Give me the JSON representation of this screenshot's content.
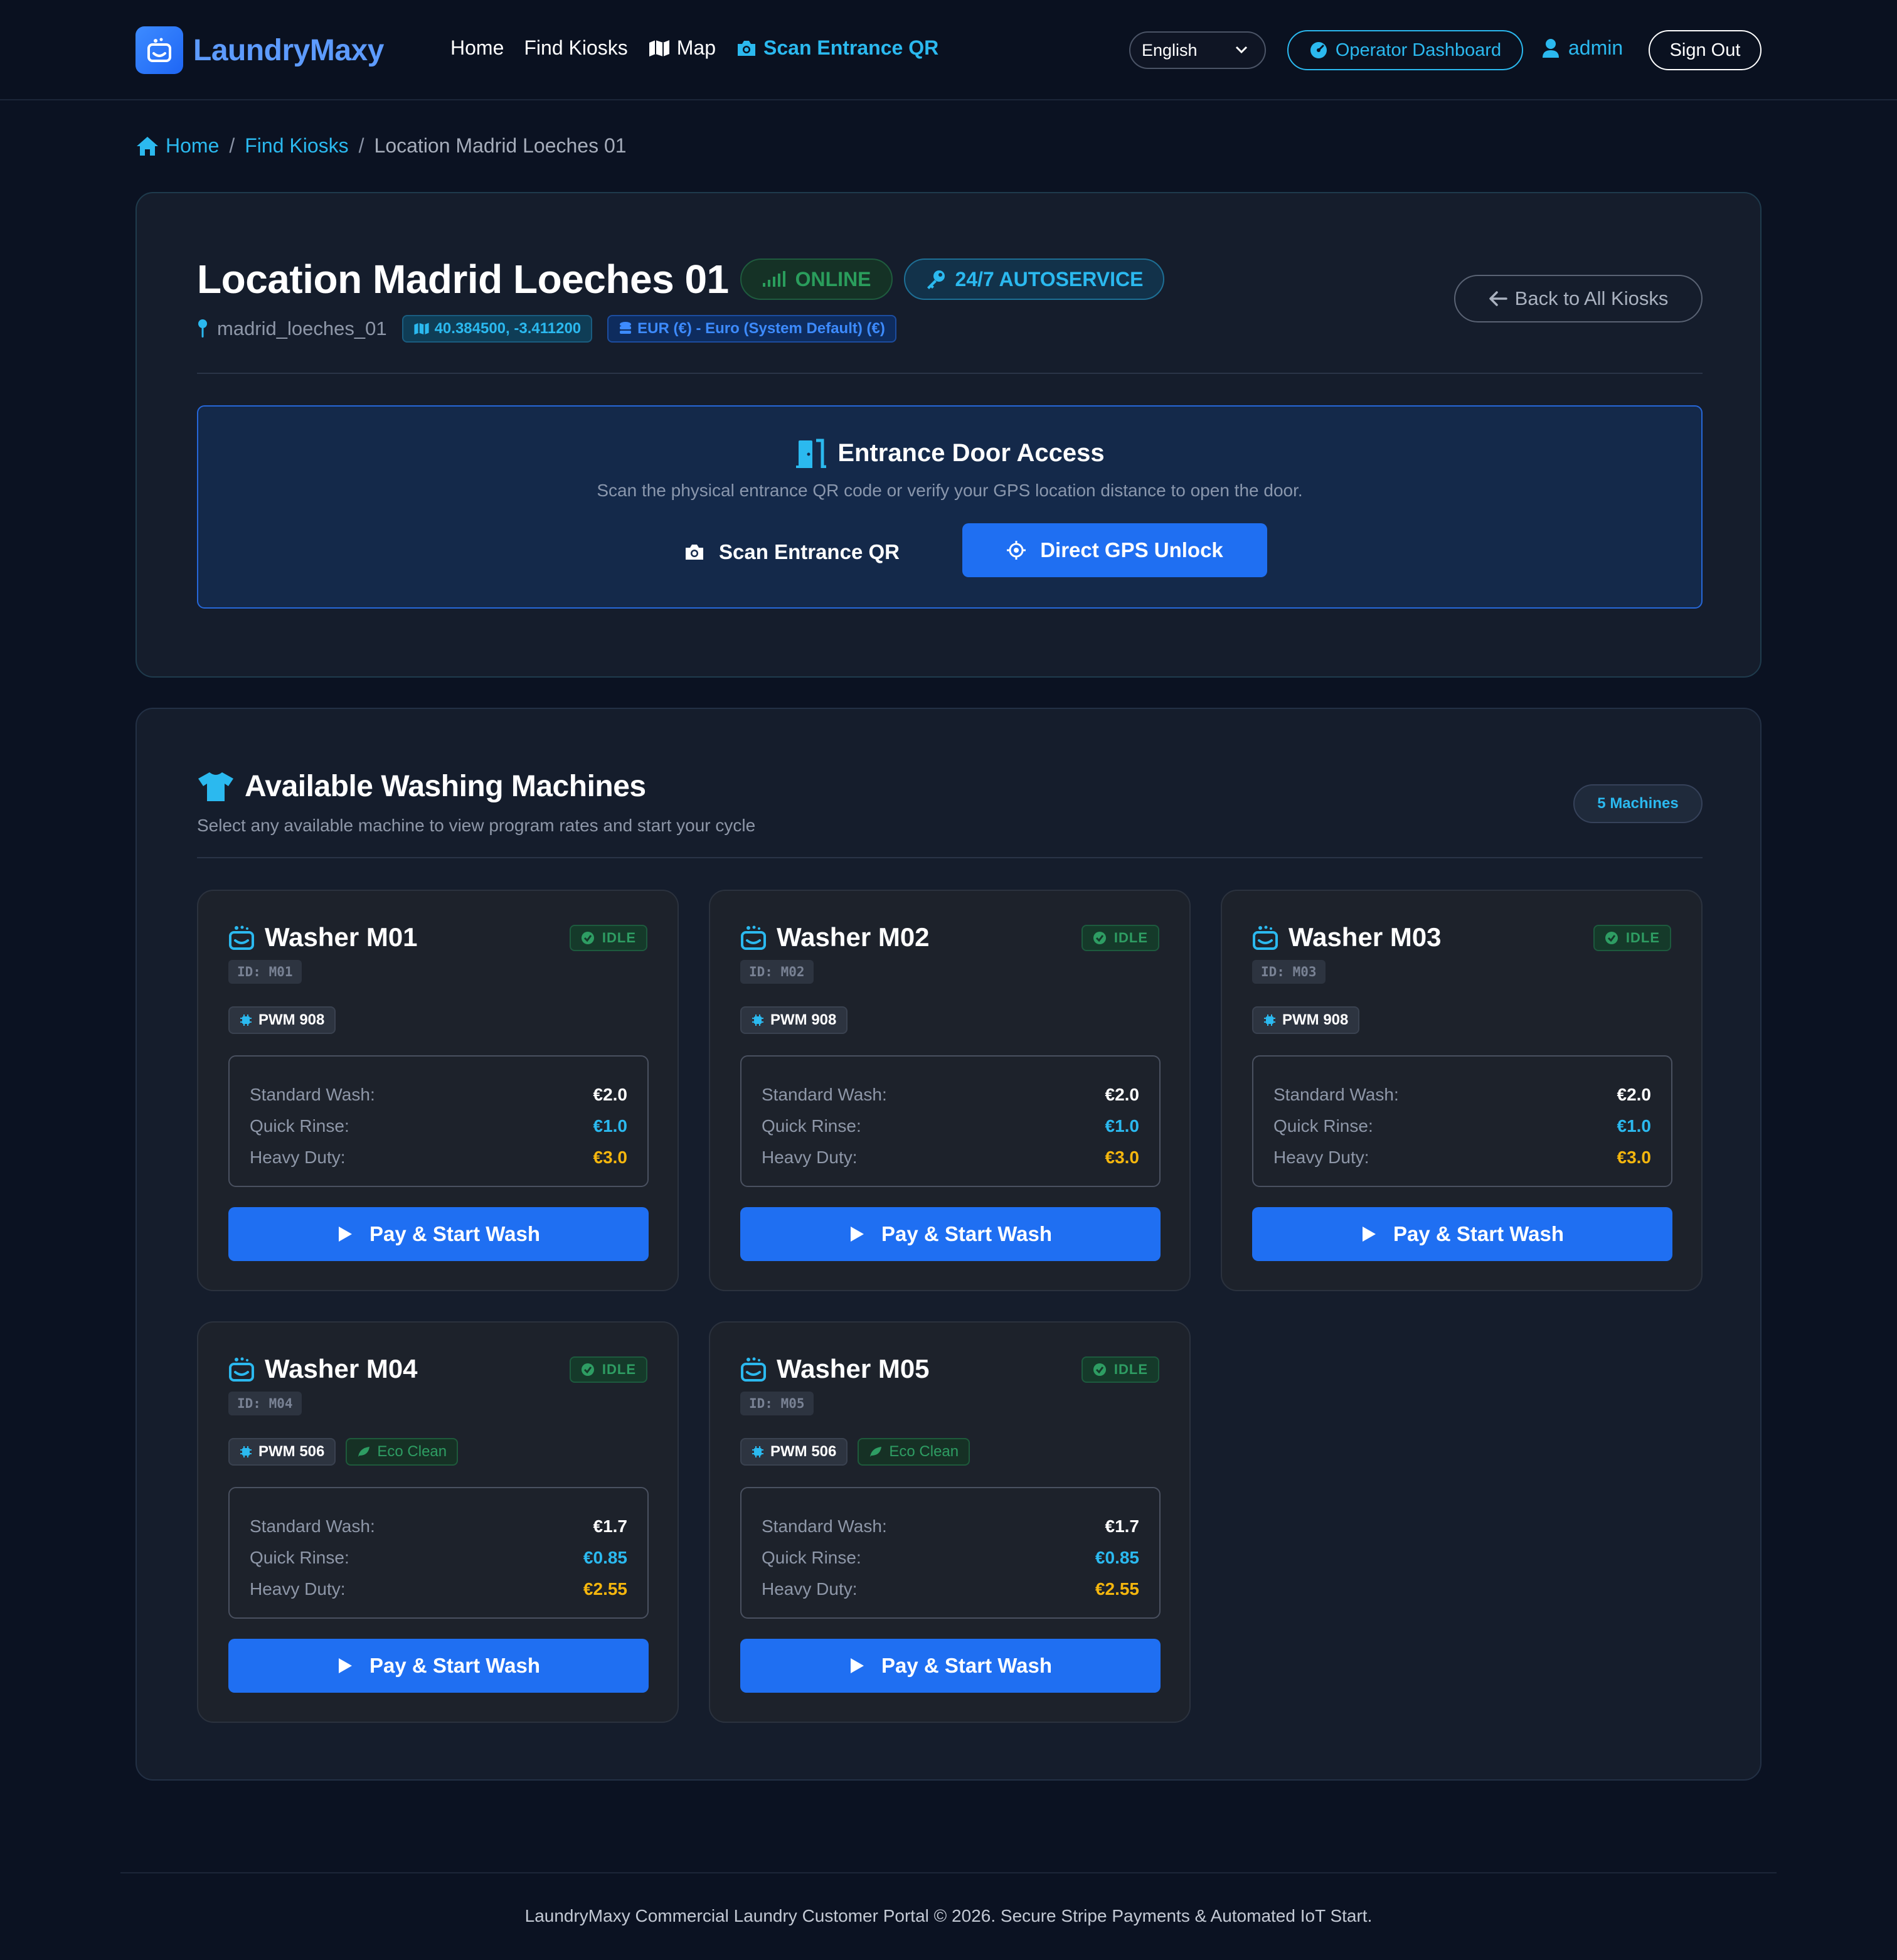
{
  "navbar": {
    "brand": "LaundryMaxy",
    "links": [
      {
        "label": "Home",
        "icon": "none"
      },
      {
        "label": "Find Kiosks",
        "icon": "none"
      },
      {
        "label": "Map",
        "icon": "map-icon"
      },
      {
        "label": "Scan Entrance QR",
        "icon": "camera-icon",
        "active": true
      }
    ],
    "language": "English",
    "operator_dashboard": "Operator Dashboard",
    "username": "admin",
    "sign_out": "Sign Out"
  },
  "breadcrumb": {
    "home": "Home",
    "find_kiosks": "Find Kiosks",
    "separator": "/",
    "current": "Location Madrid Loeches 01"
  },
  "location": {
    "title": "Location Madrid Loeches 01",
    "status": "ONLINE",
    "service": "24/7 AUTOSERVICE",
    "slug": "madrid_loeches_01",
    "coordinates": "40.384500, -3.411200",
    "currency": "EUR (€) - Euro (System Default) (€)",
    "back_button": "Back to All Kiosks"
  },
  "door_access": {
    "title": "Entrance Door Access",
    "subtitle": "Scan the physical entrance QR code or verify your GPS location distance to open the door.",
    "scan_button": "Scan Entrance QR",
    "gps_button": "Direct GPS Unlock"
  },
  "machines_section": {
    "title": "Available Washing Machines",
    "subtitle": "Select any available machine to view program rates and start your cycle",
    "count": "5 Machines",
    "labels": {
      "standard": "Standard Wash:",
      "quick": "Quick Rinse:",
      "heavy": "Heavy Duty:",
      "pay_button": "Pay & Start Wash"
    },
    "machines": [
      {
        "name": "Washer M01",
        "id": "ID: M01",
        "status": "IDLE",
        "model": "PWM 908",
        "eco": "",
        "standard": "€2.0",
        "quick": "€1.0",
        "heavy": "€3.0"
      },
      {
        "name": "Washer M02",
        "id": "ID: M02",
        "status": "IDLE",
        "model": "PWM 908",
        "eco": "",
        "standard": "€2.0",
        "quick": "€1.0",
        "heavy": "€3.0"
      },
      {
        "name": "Washer M03",
        "id": "ID: M03",
        "status": "IDLE",
        "model": "PWM 908",
        "eco": "",
        "standard": "€2.0",
        "quick": "€1.0",
        "heavy": "€3.0"
      },
      {
        "name": "Washer M04",
        "id": "ID: M04",
        "status": "IDLE",
        "model": "PWM 506",
        "eco": "Eco Clean",
        "standard": "€1.7",
        "quick": "€0.85",
        "heavy": "€2.55"
      },
      {
        "name": "Washer M05",
        "id": "ID: M05",
        "status": "IDLE",
        "model": "PWM 506",
        "eco": "Eco Clean",
        "standard": "€1.7",
        "quick": "€0.85",
        "heavy": "€2.55"
      }
    ]
  },
  "footer": {
    "text": "LaundryMaxy Commercial Laundry Customer Portal © 2026. Secure Stripe Payments & Automated IoT Start."
  },
  "colors": {
    "background": "#0b1222",
    "accent_cyan": "#2bb9ef",
    "primary_blue": "#1f6ff2",
    "success_green": "#2e9d63",
    "warning_yellow": "#f4b60e"
  }
}
